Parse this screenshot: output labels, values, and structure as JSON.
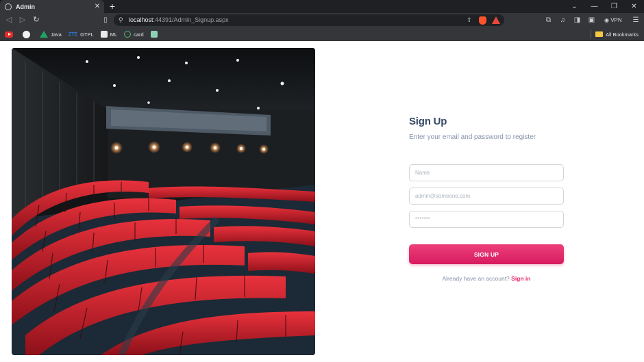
{
  "browser": {
    "tab_title": "Admin",
    "tab_close": "✕",
    "new_tab": "+",
    "url_host": "localhost",
    "url_path": ":44391/Admin_Signup.aspx",
    "vpn_label": "VPN",
    "all_bookmarks": "All Bookmarks",
    "bookmarks": [
      {
        "label": "",
        "icon": "youtube-icon"
      },
      {
        "label": "",
        "icon": "github-icon"
      },
      {
        "label": "Java",
        "icon": "google-drive-icon"
      },
      {
        "label": "GTPL",
        "icon": "zte-icon",
        "prefix": "ZTE"
      },
      {
        "label": "ML",
        "icon": "ml-icon"
      },
      {
        "label": "card",
        "icon": "card-icon"
      },
      {
        "label": "",
        "icon": "bookmark-icon"
      }
    ]
  },
  "form": {
    "title": "Sign Up",
    "subtitle": "Enter your email and password to register",
    "name_placeholder": "Name",
    "email_placeholder": "admin@someone.com",
    "password_placeholder": "*******",
    "submit_label": "SIGN UP",
    "footer_text": "Already have an account? ",
    "footer_link": "Sign in"
  },
  "hero_image": {
    "alt": "cinema-auditorium-photo",
    "seat_color": "#c81e2a",
    "wall_color": "#1a1d20"
  }
}
